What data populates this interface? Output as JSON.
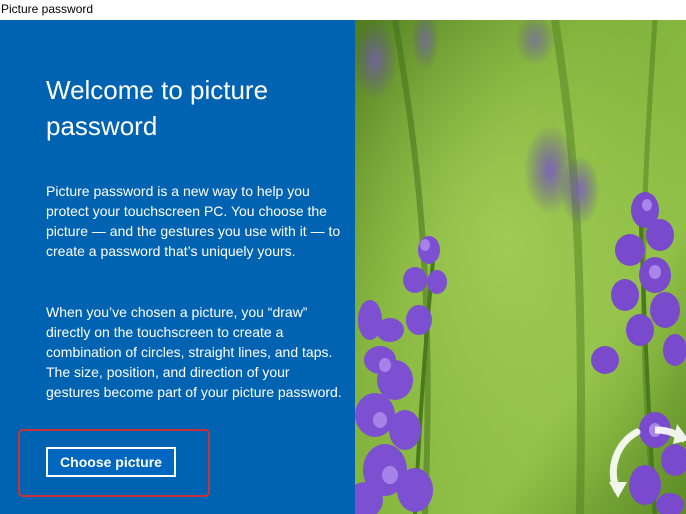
{
  "window": {
    "title": "Picture password"
  },
  "panel": {
    "heading": "Welcome to picture password",
    "paragraph1": "Picture password is a new way to help you protect your touchscreen PC. You choose the picture — and the gestures you use with it — to create a password that’s uniquely yours.",
    "paragraph2": "When you’ve chosen a picture, you “draw” directly on the touchscreen to create a combination of circles, straight lines, and taps. The size, position, and direction of your gestures become part of your picture password.",
    "choose_button": "Choose picture"
  },
  "colors": {
    "panel_bg": "#0063b1",
    "highlight_border": "#c8313a"
  },
  "photo": {
    "subject": "lavender-flowers",
    "overlay_icon": "rotate-gesture-icon"
  }
}
